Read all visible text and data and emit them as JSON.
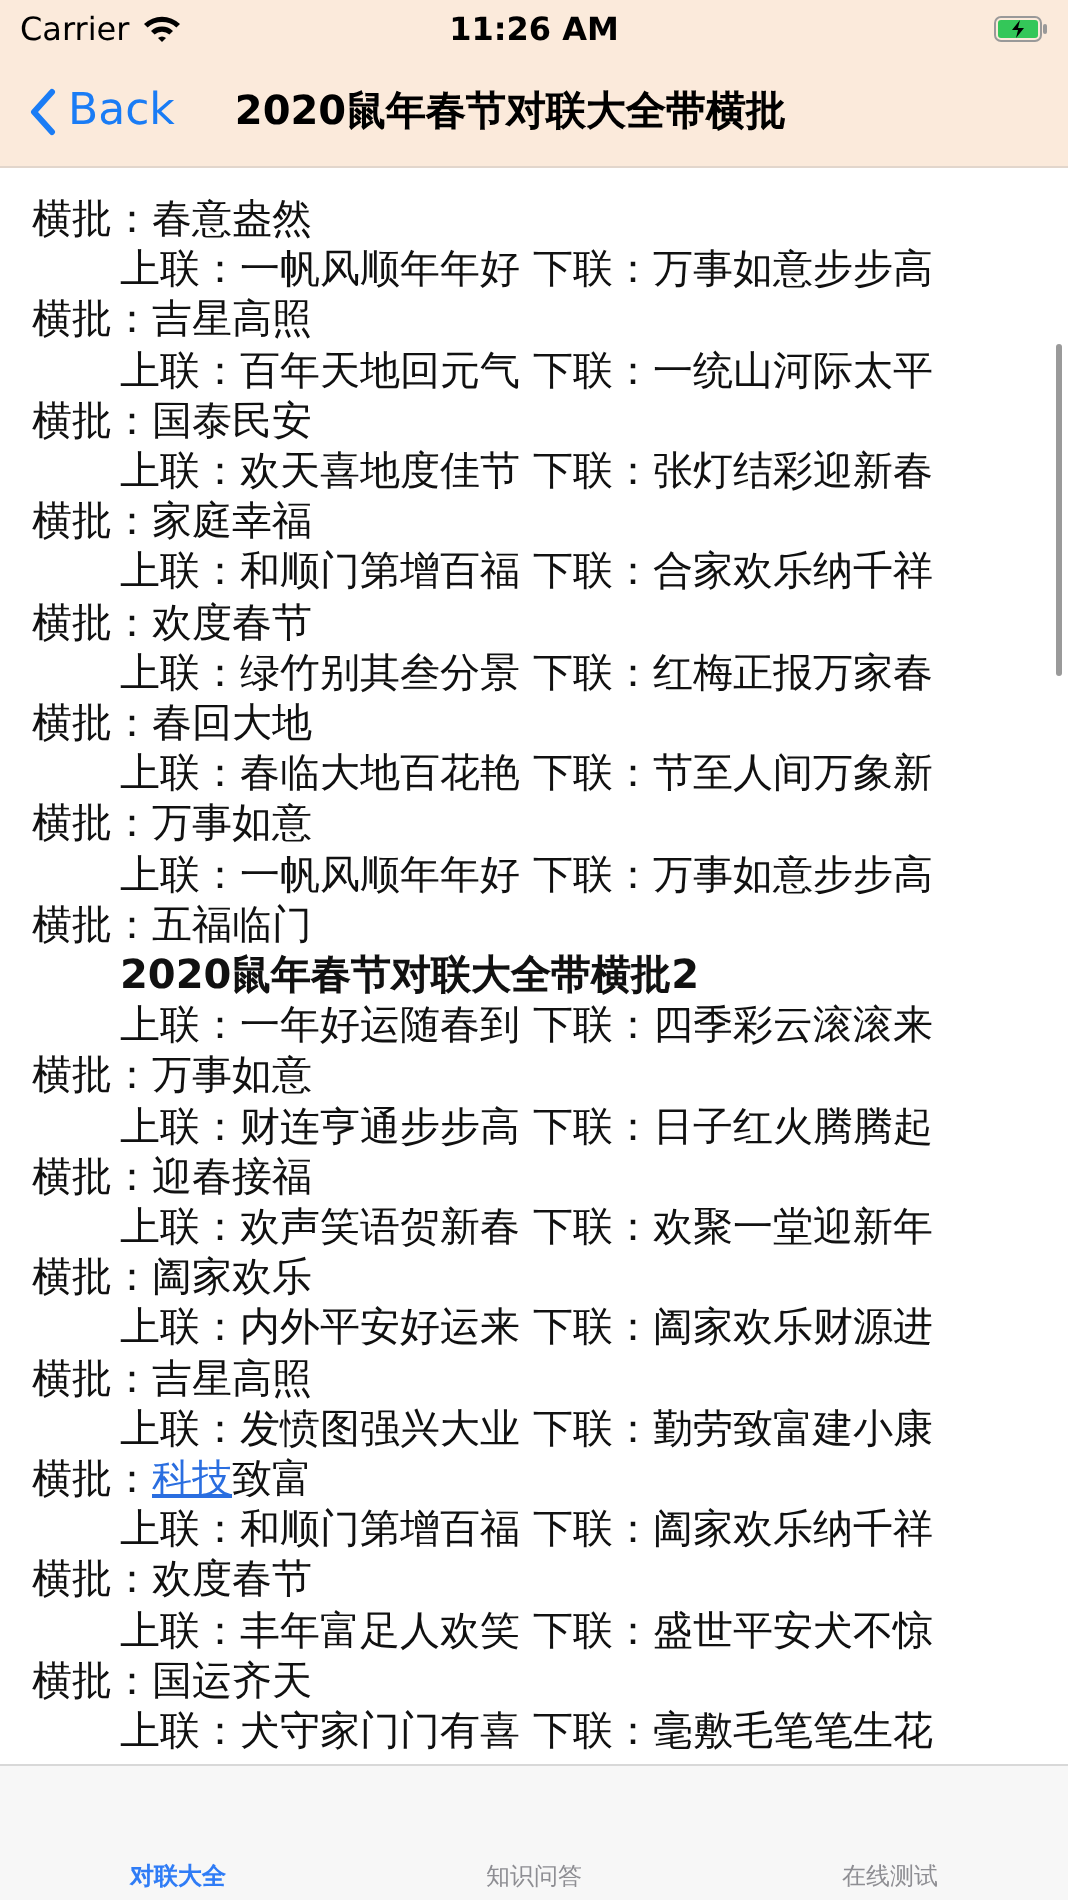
{
  "status_bar": {
    "carrier": "Carrier",
    "time": "11:26 AM",
    "battery_charging": true
  },
  "nav_bar": {
    "back": "Back",
    "title": "2020鼠年春节对联大全带横批"
  },
  "content": [
    {
      "kind": "banner",
      "text": "横批：春意盎然"
    },
    {
      "kind": "couplet",
      "text": "上联：一帆风顺年年好 下联：万事如意步步高"
    },
    {
      "kind": "banner",
      "text": "横批：吉星高照"
    },
    {
      "kind": "couplet",
      "text": "上联：百年天地回元气 下联：一统山河际太平"
    },
    {
      "kind": "banner",
      "text": "横批：国泰民安"
    },
    {
      "kind": "couplet",
      "text": "上联：欢天喜地度佳节 下联：张灯结彩迎新春"
    },
    {
      "kind": "banner",
      "text": "横批：家庭幸福"
    },
    {
      "kind": "couplet",
      "text": "上联：和顺门第增百福 下联：合家欢乐纳千祥"
    },
    {
      "kind": "banner",
      "text": "横批：欢度春节"
    },
    {
      "kind": "couplet",
      "text": "上联：绿竹别其叁分景 下联：红梅正报万家春"
    },
    {
      "kind": "banner",
      "text": "横批：春回大地"
    },
    {
      "kind": "couplet",
      "text": "上联：春临大地百花艳 下联：节至人间万象新"
    },
    {
      "kind": "banner",
      "text": "横批：万事如意"
    },
    {
      "kind": "couplet",
      "text": "上联：一帆风顺年年好 下联：万事如意步步高"
    },
    {
      "kind": "banner",
      "text": "横批：五福临门"
    },
    {
      "kind": "heading",
      "text": "2020鼠年春节对联大全带横批2"
    },
    {
      "kind": "couplet",
      "text": "上联：一年好运随春到 下联：四季彩云滚滚来"
    },
    {
      "kind": "banner",
      "text": "横批：万事如意"
    },
    {
      "kind": "couplet",
      "text": "上联：财连亨通步步高 下联：日子红火腾腾起"
    },
    {
      "kind": "banner",
      "text": "横批：迎春接福"
    },
    {
      "kind": "couplet",
      "text": "上联：欢声笑语贺新春 下联：欢聚一堂迎新年"
    },
    {
      "kind": "banner",
      "text": "横批：阖家欢乐"
    },
    {
      "kind": "couplet",
      "text": "上联：内外平安好运来 下联：阖家欢乐财源进"
    },
    {
      "kind": "banner",
      "text": "横批：吉星高照"
    },
    {
      "kind": "couplet",
      "text": "上联：发愤图强兴大业 下联：勤劳致富建小康"
    },
    {
      "kind": "banner",
      "text": "横批：",
      "link": "科技",
      "after": "致富"
    },
    {
      "kind": "couplet",
      "text": "上联：和顺门第增百福 下联：阖家欢乐纳千祥"
    },
    {
      "kind": "banner",
      "text": "横批：欢度春节"
    },
    {
      "kind": "couplet",
      "text": "上联：丰年富足人欢笑 下联：盛世平安犬不惊"
    },
    {
      "kind": "banner",
      "text": "横批：国运齐天"
    },
    {
      "kind": "couplet",
      "text": "上联：犬守家门门有喜 下联：毫敷毛笔笔生花"
    }
  ],
  "tab_bar": [
    {
      "label": "对联大全",
      "selected": true
    },
    {
      "label": "知识问答",
      "selected": false
    },
    {
      "label": "在线测试",
      "selected": false
    }
  ]
}
